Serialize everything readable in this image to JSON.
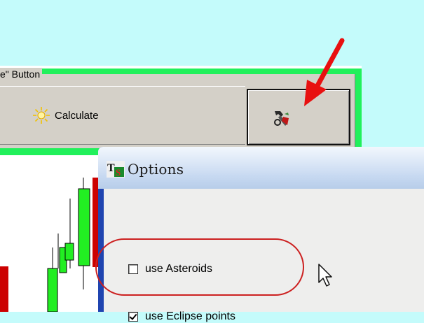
{
  "group": {
    "caption": "e\" Button"
  },
  "calculate_button": {
    "label": "Calculate",
    "icon": "sun-icon"
  },
  "options_button": {
    "icon": "options-tool-icon"
  },
  "dialog": {
    "app_icon_text": "TS",
    "title": "Options",
    "options": [
      {
        "label": "use Asteroids",
        "checked": false
      },
      {
        "label": "use Eclipse points",
        "checked": true
      }
    ]
  },
  "annotation": {
    "arrow_color": "#e81010",
    "highlight_color": "#cc2020"
  },
  "colors": {
    "background": "#c4fbfb",
    "group_green": "#21f05b",
    "dialog_title_gradient": "#c7d9f1",
    "candle_up": "#22ee22",
    "candle_down": "#cc0000"
  }
}
